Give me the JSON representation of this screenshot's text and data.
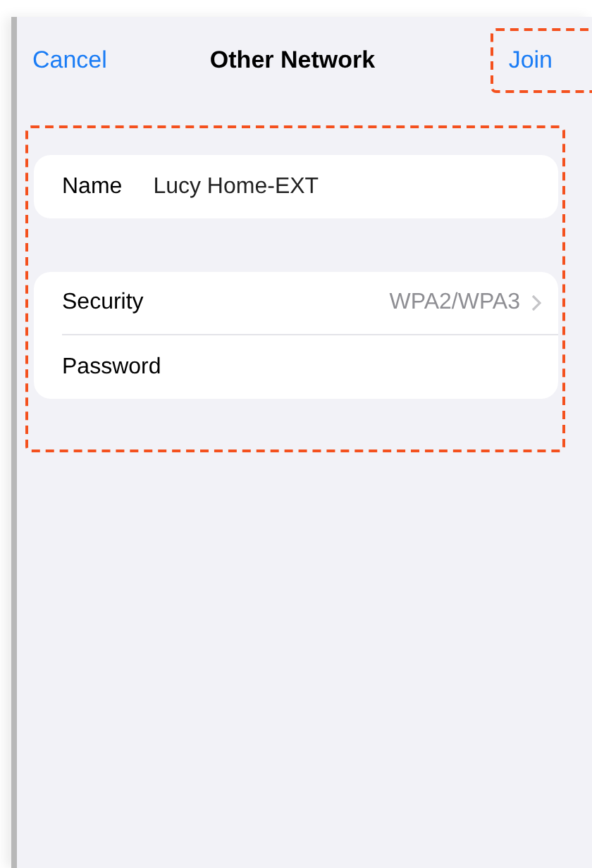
{
  "nav": {
    "cancel": "Cancel",
    "title": "Other Network",
    "join": "Join"
  },
  "name_row": {
    "label": "Name",
    "value": "Lucy Home-EXT"
  },
  "settings": [
    {
      "kind": "disclosure",
      "label": "Security",
      "value": "WPA2/WPA3"
    },
    {
      "kind": "field",
      "label": "Password"
    }
  ]
}
